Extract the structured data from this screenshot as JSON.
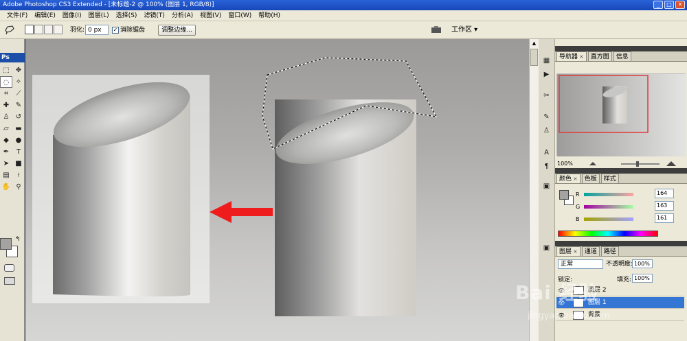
{
  "window": {
    "title": "Adobe Photoshop CS3 Extended - [未标题-2 @ 100% (图层 1, RGB/8)]",
    "min_label": "_",
    "max_label": "□",
    "close_label": "✕"
  },
  "menu": [
    {
      "label": "文件(F)"
    },
    {
      "label": "编辑(E)"
    },
    {
      "label": "图像(I)"
    },
    {
      "label": "图层(L)"
    },
    {
      "label": "选择(S)"
    },
    {
      "label": "滤镜(T)"
    },
    {
      "label": "分析(A)"
    },
    {
      "label": "视图(V)"
    },
    {
      "label": "窗口(W)"
    },
    {
      "label": "帮助(H)"
    }
  ],
  "options": {
    "feather_label": "羽化:",
    "feather_value": "0 px",
    "antialias_label": "消除锯齿",
    "antialias_checked": "✓",
    "refine_edge_label": "调整边缘...",
    "workspace_label": "工作区 ▾"
  },
  "tools": {
    "ps_badge": "Ps",
    "swap_glyph": "↰"
  },
  "navigator": {
    "tabs": [
      "导航器",
      "直方图",
      "信息"
    ],
    "tab_close": "×",
    "zoom": "100%"
  },
  "color_panel": {
    "tabs": [
      "颜色",
      "色板",
      "样式"
    ],
    "channels": [
      {
        "label": "R",
        "value": "164"
      },
      {
        "label": "G",
        "value": "163"
      },
      {
        "label": "B",
        "value": "161"
      }
    ],
    "fg_color": "#a4a3a1"
  },
  "layers_panel": {
    "tabs": [
      "图层",
      "通道",
      "路径"
    ],
    "blend_mode": "正常",
    "opacity_label": "不透明度:",
    "opacity_value": "100%",
    "lock_label": "锁定:",
    "fill_label": "填充:",
    "fill_value": "100%",
    "layers": [
      {
        "name": "图层 2",
        "selected": false
      },
      {
        "name": "图层 1",
        "selected": true
      },
      {
        "name": "背景",
        "selected": false
      }
    ]
  },
  "watermark": {
    "text": "Bai 经验",
    "url": "jingyan.baidu.com"
  },
  "colors": {
    "arrow": "#ee1c1c",
    "selected_layer": "#3476d4",
    "title_bar": "#2a62d8"
  }
}
